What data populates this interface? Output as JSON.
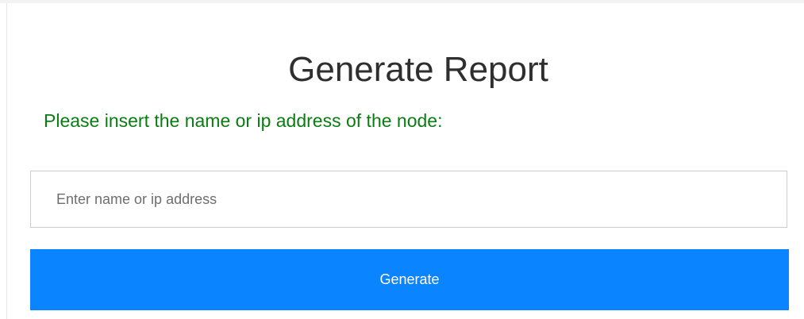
{
  "form": {
    "title": "Generate Report",
    "prompt": "Please insert the name or ip address of the node:",
    "input": {
      "value": "",
      "placeholder": "Enter name or ip address"
    },
    "button_label": "Generate"
  },
  "colors": {
    "prompt_text": "#0a7d12",
    "button_bg": "#0a84ff",
    "button_text": "#ffffff",
    "title_text": "#2f2f2f"
  }
}
